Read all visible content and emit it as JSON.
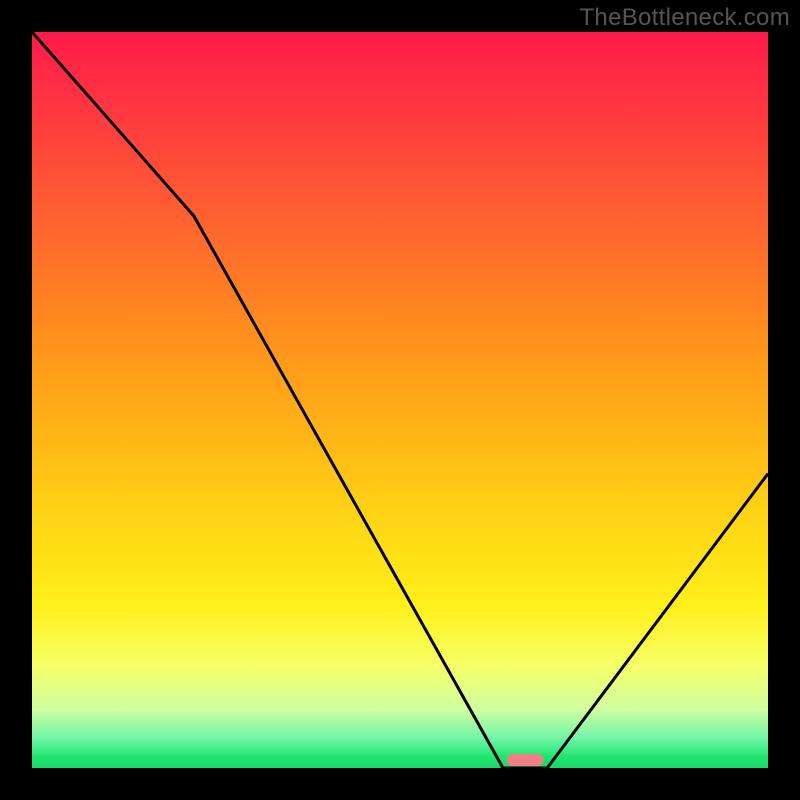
{
  "watermark": "TheBottleneck.com",
  "chart_data": {
    "type": "line",
    "title": "",
    "xlabel": "",
    "ylabel": "",
    "xlim": [
      0,
      100
    ],
    "ylim": [
      0,
      100
    ],
    "background_gradient_note": "red→orange→yellow→green (vertical) indicating bottleneck severity; green band at bottom indicates optimal",
    "series": [
      {
        "name": "bottleneck-curve",
        "x": [
          0,
          22,
          64,
          70,
          100
        ],
        "values": [
          100,
          75,
          0,
          0,
          40
        ]
      }
    ],
    "marker": {
      "name": "optimal-point",
      "x_center": 67,
      "width": 5,
      "color": "#ef7f85"
    },
    "gradient_stops": [
      {
        "pos": 0,
        "color": "#ff1a4b"
      },
      {
        "pos": 20,
        "color": "#ff5236"
      },
      {
        "pos": 45,
        "color": "#ff9a1a"
      },
      {
        "pos": 65,
        "color": "#ffd215"
      },
      {
        "pos": 78,
        "color": "#fff01a"
      },
      {
        "pos": 86,
        "color": "#f6ff66"
      },
      {
        "pos": 92,
        "color": "#d0ffa0"
      },
      {
        "pos": 96,
        "color": "#70f5a8"
      },
      {
        "pos": 98.5,
        "color": "#1fe56f"
      },
      {
        "pos": 100,
        "color": "#18d868"
      }
    ]
  }
}
